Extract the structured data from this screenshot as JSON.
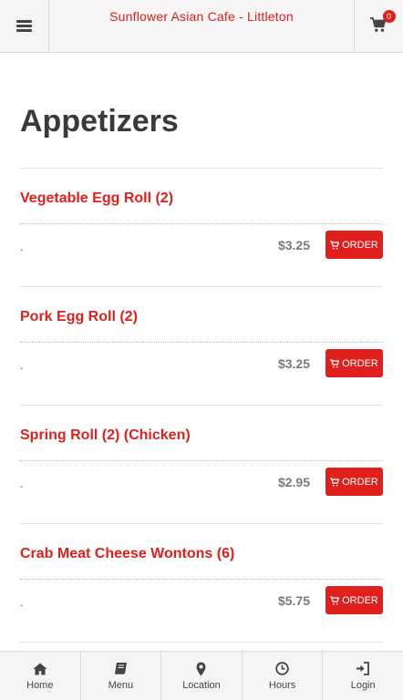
{
  "header": {
    "title": "Sunflower Asian Cafe - Littleton",
    "cart_count": "0",
    "menu_icon": "hamburger-icon",
    "cart_icon": "cart-icon"
  },
  "page": {
    "title": "Appetizers"
  },
  "items": [
    {
      "name": "Vegetable Egg Roll (2)",
      "desc": ".",
      "price": "$3.25",
      "order_label": "ORDER"
    },
    {
      "name": "Pork Egg Roll (2)",
      "desc": ".",
      "price": "$3.25",
      "order_label": "ORDER"
    },
    {
      "name": "Spring Roll (2) (Chicken)",
      "desc": ".",
      "price": "$2.95",
      "order_label": "ORDER"
    },
    {
      "name": "Crab Meat Cheese Wontons (6)",
      "desc": ".",
      "price": "$5.75",
      "order_label": "ORDER"
    }
  ],
  "tabs": [
    {
      "label": "Home",
      "icon": "home-icon"
    },
    {
      "label": "Menu",
      "icon": "book-icon"
    },
    {
      "label": "Location",
      "icon": "map-pin-icon"
    },
    {
      "label": "Hours",
      "icon": "clock-icon"
    },
    {
      "label": "Login",
      "icon": "login-icon"
    }
  ],
  "colors": {
    "accent": "#e0201c",
    "bar_bg": "#f5f5f5",
    "title_text": "#3a3a3a",
    "price_text": "#7a7a7a"
  }
}
